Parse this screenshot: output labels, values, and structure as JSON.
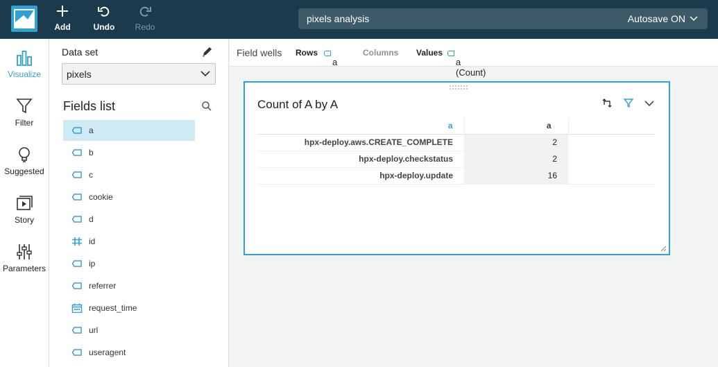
{
  "toolbar": {
    "add_label": "Add",
    "undo_label": "Undo",
    "redo_label": "Redo"
  },
  "analysis": {
    "name": "pixels analysis",
    "autosave": "Autosave ON"
  },
  "rail": {
    "items": [
      {
        "label": "Visualize",
        "icon": "bar-chart-icon"
      },
      {
        "label": "Filter",
        "icon": "funnel-icon"
      },
      {
        "label": "Suggested",
        "icon": "lightbulb-icon"
      },
      {
        "label": "Story",
        "icon": "story-icon"
      },
      {
        "label": "Parameters",
        "icon": "sliders-icon"
      }
    ]
  },
  "dataset": {
    "label": "Data set",
    "selected": "pixels"
  },
  "fields_list": {
    "title": "Fields list",
    "items": [
      {
        "name": "a",
        "type": "dimension",
        "selected": true
      },
      {
        "name": "b",
        "type": "dimension"
      },
      {
        "name": "c",
        "type": "dimension"
      },
      {
        "name": "cookie",
        "type": "dimension"
      },
      {
        "name": "d",
        "type": "dimension"
      },
      {
        "name": "id",
        "type": "measure"
      },
      {
        "name": "ip",
        "type": "dimension"
      },
      {
        "name": "referrer",
        "type": "dimension"
      },
      {
        "name": "request_time",
        "type": "date"
      },
      {
        "name": "url",
        "type": "dimension"
      },
      {
        "name": "useragent",
        "type": "dimension"
      }
    ]
  },
  "field_wells": {
    "title": "Field wells",
    "rows_label": "Rows",
    "rows_value": "a",
    "columns_label": "Columns",
    "values_label": "Values",
    "values_value": "a (Count)"
  },
  "visual": {
    "title": "Count of A by A",
    "table": {
      "row_header": "a",
      "value_header": "a",
      "rows": [
        {
          "key": "hpx-deploy.aws.CREATE_COMPLETE",
          "value": "2"
        },
        {
          "key": "hpx-deploy.checkstatus",
          "value": "2"
        },
        {
          "key": "hpx-deploy.update",
          "value": "16"
        }
      ]
    }
  },
  "colors": {
    "accent": "#2ea3d3",
    "topbar": "#1b3a4b",
    "selected_field": "#cdeaf5"
  }
}
